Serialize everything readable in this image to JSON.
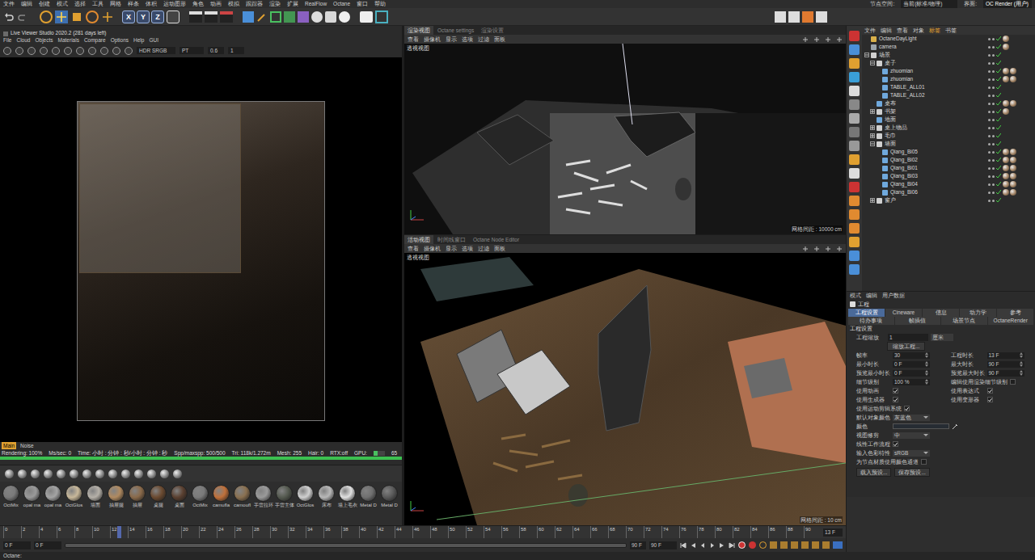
{
  "menubar": {
    "items": [
      "文件",
      "编辑",
      "创建",
      "模式",
      "选择",
      "工具",
      "网格",
      "样条",
      "体积",
      "运动图形",
      "角色",
      "动画",
      "模拟",
      "跟踪器",
      "渲染",
      "扩展",
      "RealFlow",
      "Octane",
      "窗口",
      "帮助"
    ],
    "node_space_label": "节点空间:",
    "node_space": "当前(标准/物理)",
    "layout_label": "界面:",
    "layout": "OC Render (用户)"
  },
  "toolbar": {
    "axes": [
      "X",
      "Y",
      "Z"
    ]
  },
  "live_viewer": {
    "title": "Live Viewer Studio 2020.2 (281 days left)",
    "menu": [
      "File",
      "Cloud",
      "Objects",
      "Materials",
      "Compare",
      "Options",
      "Help",
      "GUI"
    ],
    "color_space": "HDR SRGB",
    "kernel": "PT",
    "exposure": "0.6",
    "gamma": "1",
    "passes": [
      {
        "label": "Main",
        "selected": true
      },
      {
        "label": "Noise",
        "selected": false
      }
    ],
    "stats": [
      "Rendering: 100%",
      "Ms/sec: 0",
      "Time: 小时 : 分钟 : 秒/小时 : 分钟 : 秒",
      "Spp/maxspp: 500/500",
      "Tri: 118k/1.272m",
      "Mesh: 255",
      "Hair: 0",
      "RTX:off"
    ],
    "gpu": {
      "label": "GPU:",
      "level": 0.35,
      "reading": "65"
    },
    "progress": {
      "level": 1
    }
  },
  "materials": [
    {
      "label": "OctMix",
      "color": "#7a7a7a"
    },
    {
      "label": "opal ma",
      "color": "#9a9a9a"
    },
    {
      "label": "opal ma",
      "color": "#a4a4a4"
    },
    {
      "label": "OctGlos",
      "color": "#c8b89a"
    },
    {
      "label": "墙面",
      "color": "#b5b0a8"
    },
    {
      "label": "抽屉腿",
      "color": "#b08a60"
    },
    {
      "label": "抽屉",
      "color": "#8a6a4a"
    },
    {
      "label": "桌腿",
      "color": "#6b4a30"
    },
    {
      "label": "桌面",
      "color": "#5a4030"
    },
    {
      "label": "OctMix",
      "color": "#7a7a7a"
    },
    {
      "label": "camufla",
      "color": "#c0703a"
    },
    {
      "label": "camoufl",
      "color": "#8a7050"
    },
    {
      "label": "手雷拉环",
      "color": "#9a9a9a"
    },
    {
      "label": "手雷主体",
      "color": "#555a50"
    },
    {
      "label": "OctGlos",
      "color": "#d0d0d0"
    },
    {
      "label": "床布",
      "color": "#b8b8b8"
    },
    {
      "label": "墙上毛衣",
      "color": "#e0e0e0"
    },
    {
      "label": "Metal D",
      "color": "#707070"
    },
    {
      "label": "Metal D",
      "color": "#5a5a5a"
    }
  ],
  "viewports": [
    {
      "tabs": [
        {
          "label": "渲染视图",
          "selected": true
        },
        {
          "label": "Octane settings",
          "selected": false
        },
        {
          "label": "渲染设置",
          "selected": false
        }
      ],
      "menu": [
        "查看",
        "摄像机",
        "显示",
        "选项",
        "过滤",
        "面板"
      ],
      "view": "透视视图",
      "grid": "网格间距 : 10000 cm"
    },
    {
      "tabs": [
        {
          "label": "活动视图",
          "selected": true
        },
        {
          "label": "时间线窗口",
          "selected": false
        },
        {
          "label": "Octane Node Editor",
          "selected": false
        }
      ],
      "menu": [
        "查看",
        "摄像机",
        "显示",
        "选项",
        "过滤",
        "面板"
      ],
      "view": "透视视图",
      "grid": "网格间距 : 10 cm"
    }
  ],
  "object_manager": {
    "menu": [
      "文件",
      "编辑",
      "查看",
      "对象",
      "标签",
      "书签"
    ],
    "items": [
      {
        "name": "OctaneDayLight",
        "depth": 0,
        "kind": "light",
        "group": false,
        "expanded": false,
        "selected": false,
        "tags": 1
      },
      {
        "name": "camera",
        "depth": 0,
        "kind": "camera",
        "group": false,
        "expanded": false,
        "selected": false,
        "tags": 1
      },
      {
        "name": "场景",
        "depth": 0,
        "kind": "null",
        "group": true,
        "expanded": true,
        "selected": false,
        "tags": 0
      },
      {
        "name": "桌子",
        "depth": 1,
        "kind": "null",
        "group": true,
        "expanded": true,
        "selected": false,
        "tags": 0
      },
      {
        "name": "zhuomian",
        "depth": 2,
        "kind": "object",
        "group": false,
        "expanded": false,
        "selected": false,
        "tags": 2
      },
      {
        "name": "zhuomian",
        "depth": 2,
        "kind": "object",
        "group": false,
        "expanded": false,
        "selected": false,
        "tags": 2
      },
      {
        "name": "TABLE_ALL01",
        "depth": 2,
        "kind": "object",
        "group": false,
        "expanded": false,
        "selected": false,
        "tags": 0
      },
      {
        "name": "TABLE_ALL02",
        "depth": 2,
        "kind": "object",
        "group": false,
        "expanded": false,
        "selected": false,
        "tags": 0
      },
      {
        "name": "桌布",
        "depth": 1,
        "kind": "object",
        "group": false,
        "expanded": false,
        "selected": false,
        "tags": 2
      },
      {
        "name": "书架",
        "depth": 1,
        "kind": "null",
        "group": true,
        "expanded": false,
        "selected": false,
        "tags": 1
      },
      {
        "name": "地面",
        "depth": 1,
        "kind": "object",
        "group": false,
        "expanded": false,
        "selected": false,
        "tags": 0
      },
      {
        "name": "桌上物品",
        "depth": 1,
        "kind": "null",
        "group": true,
        "expanded": false,
        "selected": false,
        "tags": 0
      },
      {
        "name": "毛巾",
        "depth": 1,
        "kind": "null",
        "group": true,
        "expanded": false,
        "selected": false,
        "tags": 0
      },
      {
        "name": "墙面",
        "depth": 1,
        "kind": "null",
        "group": true,
        "expanded": true,
        "selected": false,
        "tags": 0
      },
      {
        "name": "Qiang_Bi05",
        "depth": 2,
        "kind": "object",
        "group": false,
        "expanded": false,
        "selected": false,
        "tags": 2
      },
      {
        "name": "Qiang_Bi02",
        "depth": 2,
        "kind": "object",
        "group": false,
        "expanded": false,
        "selected": false,
        "tags": 2
      },
      {
        "name": "Qiang_Bi01",
        "depth": 2,
        "kind": "object",
        "group": false,
        "expanded": false,
        "selected": false,
        "tags": 2
      },
      {
        "name": "Qiang_Bi03",
        "depth": 2,
        "kind": "object",
        "group": false,
        "expanded": false,
        "selected": false,
        "tags": 2
      },
      {
        "name": "Qiang_Bi04",
        "depth": 2,
        "kind": "object",
        "group": false,
        "expanded": false,
        "selected": false,
        "tags": 2
      },
      {
        "name": "Qiang_Bi06",
        "depth": 2,
        "kind": "object",
        "group": false,
        "expanded": false,
        "selected": false,
        "tags": 2
      },
      {
        "name": "窗户",
        "depth": 1,
        "kind": "null",
        "group": true,
        "expanded": false,
        "selected": false,
        "tags": 0
      }
    ]
  },
  "attributes": {
    "menu": [
      "模式",
      "编辑",
      "用户数据"
    ],
    "heading": "工程",
    "tabs": [
      [
        {
          "label": "工程设置",
          "selected": true
        },
        {
          "label": "Cineware",
          "selected": false
        },
        {
          "label": "信息",
          "selected": false
        },
        {
          "label": "动力学",
          "selected": false
        },
        {
          "label": "参考",
          "selected": false
        }
      ],
      [
        {
          "label": "待办事项",
          "selected": false
        },
        {
          "label": "帧插值",
          "selected": false
        },
        {
          "label": "场景节点",
          "selected": false
        },
        {
          "label": "OctaneRender",
          "selected": false
        }
      ]
    ],
    "section": "工程设置",
    "scale": {
      "label": "工程缩放",
      "value": "1",
      "unit": "厘米"
    },
    "scale_button": "缩放工程...",
    "rows": [
      [
        {
          "label": "帧率",
          "kind": "field",
          "value": "30"
        },
        {
          "label": "工程时长",
          "kind": "field",
          "value": "13 F"
        }
      ],
      [
        {
          "label": "最小时长",
          "kind": "field",
          "value": "0 F"
        },
        {
          "label": "最大时长",
          "kind": "field",
          "value": "90 F"
        }
      ],
      [
        {
          "label": "预览最小时长",
          "kind": "field",
          "value": "0 F"
        },
        {
          "label": "预览最大时长",
          "kind": "field",
          "value": "90 F"
        }
      ],
      [
        {
          "label": "细节级别",
          "kind": "field",
          "value": "100 %"
        },
        {
          "label": "编辑使用渲染细节级别",
          "kind": "check",
          "checked": false
        }
      ],
      [
        {
          "label": "使用动画",
          "kind": "check",
          "checked": true
        },
        {
          "label": "使用表达式",
          "kind": "check",
          "checked": true
        }
      ],
      [
        {
          "label": "使用生成器",
          "kind": "check",
          "checked": true
        },
        {
          "label": "使用变形器",
          "kind": "check",
          "checked": true
        }
      ],
      [
        {
          "label": "使用运动剪辑系统",
          "kind": "check",
          "checked": true
        }
      ],
      [
        {
          "label": "默认对象颜色",
          "kind": "dropdown",
          "value": "灰蓝色"
        }
      ],
      [
        {
          "label": "颜色",
          "kind": "color"
        }
      ],
      [
        {
          "label": "视图修剪",
          "kind": "dropdown",
          "value": "中"
        }
      ],
      [
        {
          "label": "线性工作流程",
          "kind": "check",
          "checked": true
        }
      ],
      [
        {
          "label": "输入色彩特性",
          "kind": "dropdown",
          "value": "sRGB"
        }
      ],
      [
        {
          "label": "为节点材质使用颜色通道",
          "kind": "check",
          "checked": false
        }
      ]
    ],
    "buttons": [
      "载入预设...",
      "保存预设..."
    ]
  },
  "timeline": {
    "ticks": [
      "0",
      "2",
      "4",
      "6",
      "8",
      "10",
      "12",
      "14",
      "16",
      "18",
      "20",
      "22",
      "24",
      "26",
      "28",
      "30",
      "32",
      "34",
      "36",
      "38",
      "40",
      "42",
      "44",
      "46",
      "48",
      "50",
      "52",
      "54",
      "56",
      "58",
      "60",
      "62",
      "64",
      "66",
      "68",
      "70",
      "72",
      "74",
      "76",
      "78",
      "80",
      "82",
      "84",
      "86",
      "88",
      "90"
    ],
    "current": "13 F",
    "playhead": {
      "level": 0.144
    },
    "start": "0 F",
    "preview_start": "0 F",
    "preview_end": "90 F",
    "end": "90 F"
  },
  "status_bar": "Octane:"
}
